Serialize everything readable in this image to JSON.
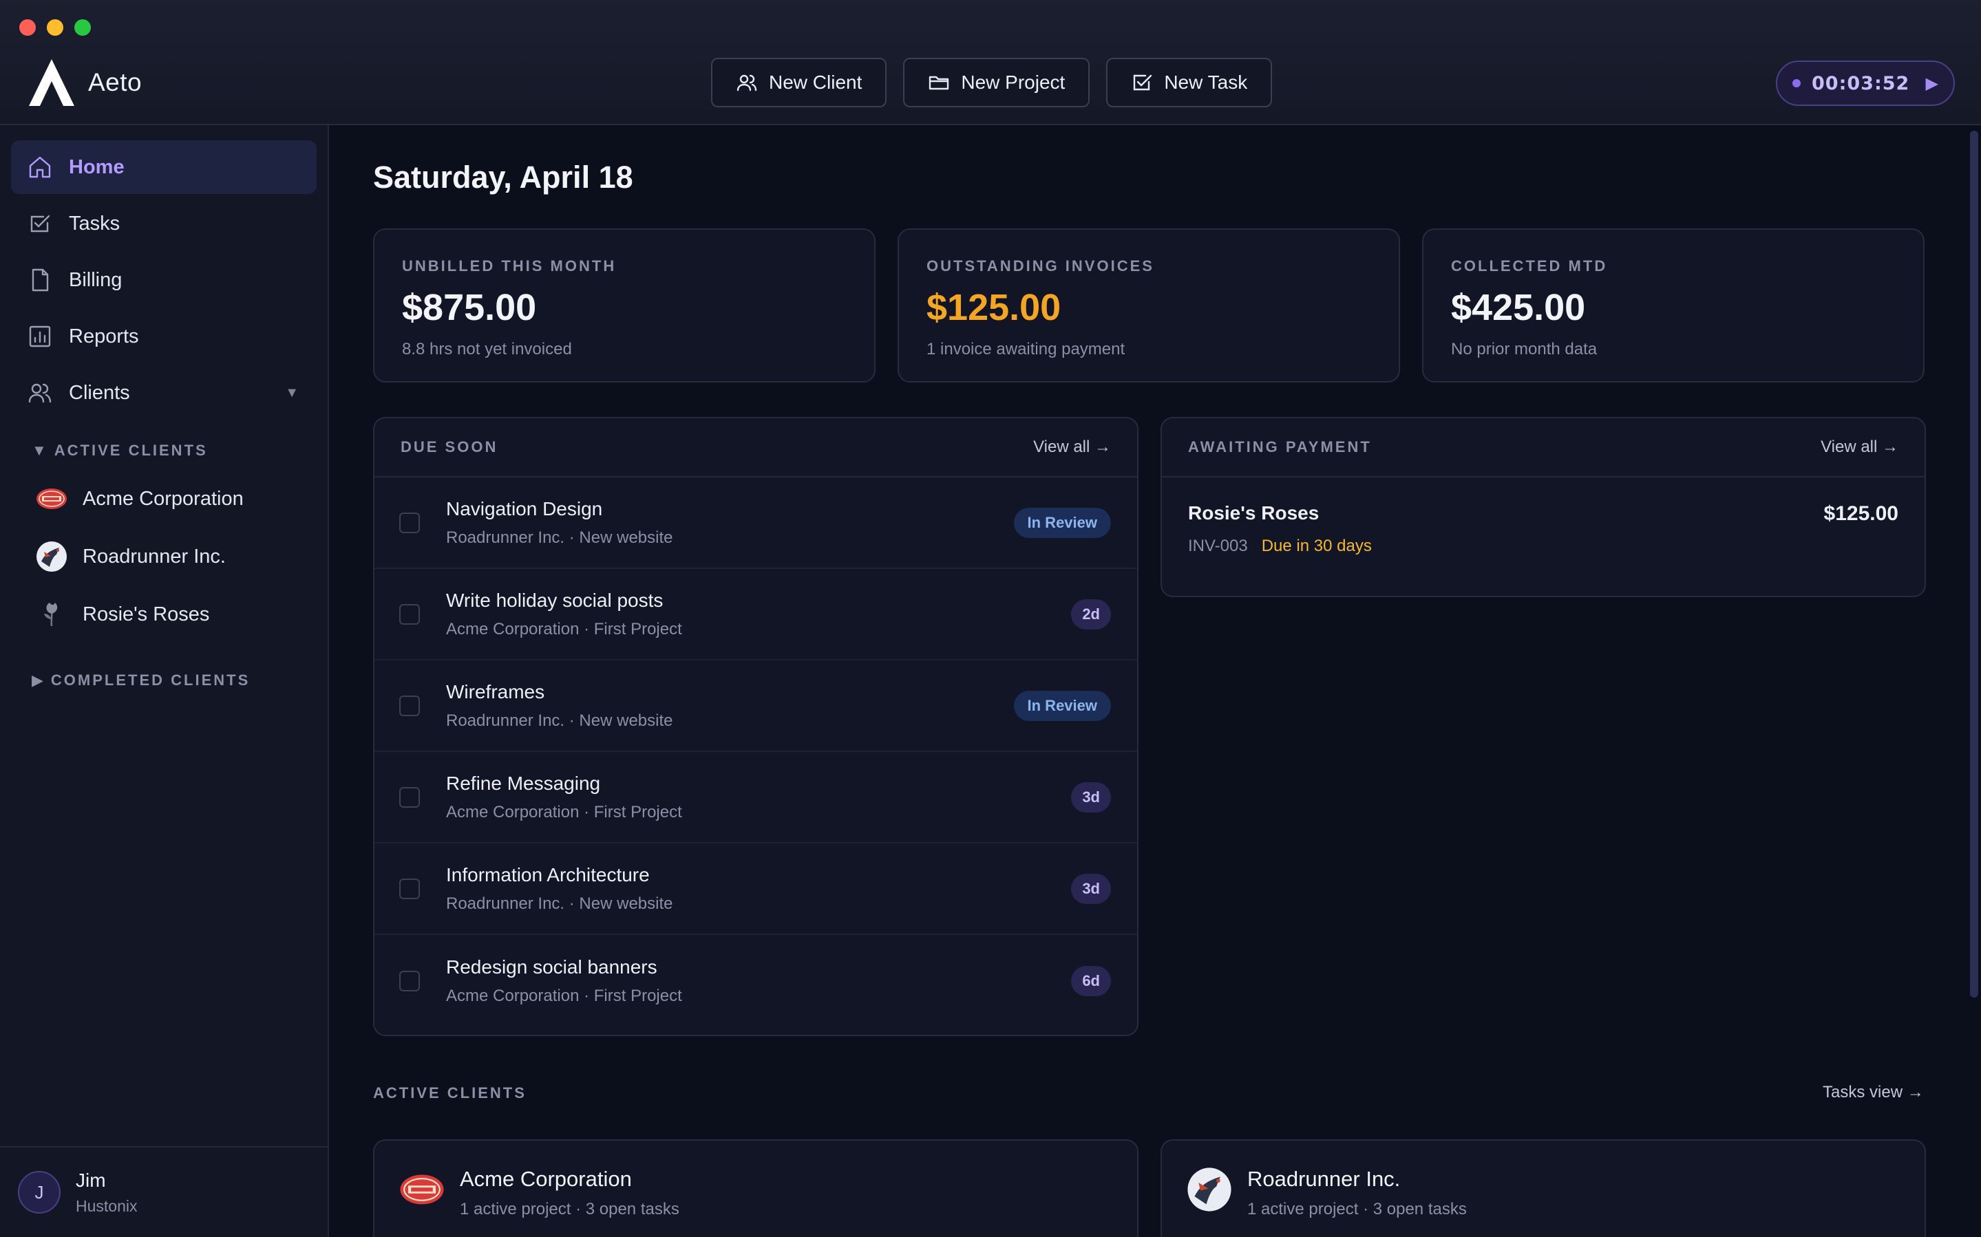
{
  "app": {
    "name": "Aeto"
  },
  "toolbar": {
    "new_client": "New Client",
    "new_project": "New Project",
    "new_task": "New Task",
    "timer": "00:03:52"
  },
  "sidebar": {
    "items": [
      {
        "label": "Home",
        "icon": "home-icon",
        "active": true
      },
      {
        "label": "Tasks",
        "icon": "checkbox-icon"
      },
      {
        "label": "Billing",
        "icon": "document-icon"
      },
      {
        "label": "Reports",
        "icon": "bar-chart-icon"
      },
      {
        "label": "Clients",
        "icon": "users-icon"
      }
    ],
    "active_clients_label": "ACTIVE CLIENTS",
    "active_clients": [
      {
        "name": "Acme Corporation",
        "icon": "acme-logo-icon"
      },
      {
        "name": "Roadrunner Inc.",
        "icon": "roadrunner-logo-icon"
      },
      {
        "name": "Rosie's Roses",
        "icon": "rose-logo-icon"
      }
    ],
    "completed_clients_label": "COMPLETED CLIENTS",
    "user": {
      "initial": "J",
      "name": "Jim",
      "org": "Hustonix"
    }
  },
  "main": {
    "date": "Saturday, April 18",
    "stats": [
      {
        "label": "UNBILLED THIS MONTH",
        "value": "$875.00",
        "sub": "8.8 hrs not yet invoiced"
      },
      {
        "label": "OUTSTANDING INVOICES",
        "value": "$125.00",
        "sub": "1 invoice awaiting payment",
        "color": "#f5a524"
      },
      {
        "label": "COLLECTED MTD",
        "value": "$425.00",
        "sub": "No prior month data"
      }
    ],
    "due_soon": {
      "title": "DUE SOON",
      "link": "View all →",
      "tasks": [
        {
          "title": "Navigation Design",
          "meta": "Roadrunner Inc. · New website",
          "badge": "In Review",
          "badge_type": "review"
        },
        {
          "title": "Write holiday social posts",
          "meta": "Acme Corporation · First Project",
          "badge": "2d",
          "badge_type": "days"
        },
        {
          "title": "Wireframes",
          "meta": "Roadrunner Inc. · New website",
          "badge": "In Review",
          "badge_type": "review"
        },
        {
          "title": "Refine Messaging",
          "meta": "Acme Corporation · First Project",
          "badge": "3d",
          "badge_type": "days"
        },
        {
          "title": "Information Architecture",
          "meta": "Roadrunner Inc. · New website",
          "badge": "3d",
          "badge_type": "days"
        },
        {
          "title": "Redesign social banners",
          "meta": "Acme Corporation · First Project",
          "badge": "6d",
          "badge_type": "days"
        }
      ]
    },
    "awaiting_payment": {
      "title": "AWAITING PAYMENT",
      "link": "View all →",
      "invoice": {
        "client": "Rosie's Roses",
        "number": "INV-003",
        "due": "Due in 30 days",
        "amount": "$125.00"
      }
    },
    "active_clients": {
      "title": "ACTIVE CLIENTS",
      "link": "Tasks view →",
      "cards": [
        {
          "name": "Acme Corporation",
          "meta": "1 active project · 3 open tasks"
        },
        {
          "name": "Roadrunner Inc.",
          "meta": "1 active project · 3 open tasks"
        }
      ]
    }
  },
  "colors": {
    "accent": "#b39cff",
    "warning": "#f5a524",
    "background": "#0b0f1c"
  }
}
